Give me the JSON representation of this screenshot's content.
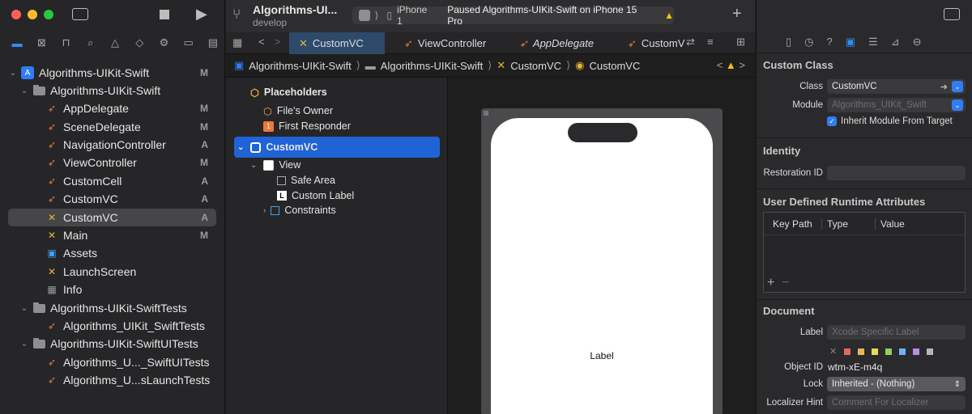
{
  "sidebar": {
    "window_controls": {
      "close": "#fe5f57",
      "minimize": "#febc2e",
      "zoom": "#28c840"
    },
    "nav_icons": [
      "folder-icon",
      "source-control-icon",
      "bookmark-icon",
      "find-icon",
      "issue-icon",
      "test-icon",
      "debug-icon",
      "breakpoint-icon",
      "report-icon"
    ],
    "items": [
      {
        "label": "Algorithms-UIKit-Swift",
        "badge": "M"
      },
      {
        "label": "Algorithms-UIKit-Swift",
        "badge": ""
      },
      {
        "label": "AppDelegate",
        "badge": "M"
      },
      {
        "label": "SceneDelegate",
        "badge": "M"
      },
      {
        "label": "NavigationController",
        "badge": "A"
      },
      {
        "label": "ViewController",
        "badge": "M"
      },
      {
        "label": "CustomCell",
        "badge": "A"
      },
      {
        "label": "CustomVC",
        "badge": "A"
      },
      {
        "label": "CustomVC",
        "badge": "A"
      },
      {
        "label": "Main",
        "badge": "M"
      },
      {
        "label": "Assets",
        "badge": ""
      },
      {
        "label": "LaunchScreen",
        "badge": ""
      },
      {
        "label": "Info",
        "badge": ""
      },
      {
        "label": "Algorithms-UIKit-SwiftTests",
        "badge": ""
      },
      {
        "label": "Algorithms_UIKit_SwiftTests",
        "badge": ""
      },
      {
        "label": "Algorithms-UIKit-SwiftUITests",
        "badge": ""
      },
      {
        "label": "Algorithms_U..._SwiftUITests",
        "badge": ""
      },
      {
        "label": "Algorithms_U...sLaunchTests",
        "badge": ""
      }
    ]
  },
  "header": {
    "project": "Algorithms-UI...",
    "branch": "develop",
    "device": "iPhone 1",
    "status": "Paused Algorithms-UIKit-Swift on iPhone 15 Pro"
  },
  "tabs": [
    "CustomVC",
    "ViewController",
    "AppDelegate",
    "CustomV"
  ],
  "jumpbar": [
    "Algorithms-UIKit-Swift",
    "Algorithms-UIKit-Swift",
    "CustomVC",
    "CustomVC"
  ],
  "outline": {
    "placeholders": "Placeholders",
    "files_owner": "File's Owner",
    "first_responder": "First Responder",
    "first_responder_badge": "1",
    "custom_vc": "CustomVC",
    "view": "View",
    "safe_area": "Safe Area",
    "custom_label": "Custom Label",
    "custom_label_icon": "L",
    "constraints": "Constraints"
  },
  "canvas": {
    "label_text": "Label"
  },
  "inspector": {
    "custom_class": {
      "title": "Custom Class",
      "class_label": "Class",
      "class_value": "CustomVC",
      "module_label": "Module",
      "module_value": "Algorithms_UIKit_Swift",
      "inherit_label": "Inherit Module From Target"
    },
    "identity": {
      "title": "Identity",
      "restoration_label": "Restoration ID",
      "restoration_value": ""
    },
    "runtime": {
      "title": "User Defined Runtime Attributes",
      "col_key": "Key Path",
      "col_type": "Type",
      "col_value": "Value",
      "add": "+",
      "remove": "−"
    },
    "document": {
      "title": "Document",
      "label_label": "Label",
      "label_placeholder": "Xcode Specific Label",
      "swatches": [
        "#e06b60",
        "#eab45a",
        "#e8d95a",
        "#8fcf67",
        "#6fb4f0",
        "#b48ee8",
        "#b7b7bb"
      ],
      "object_id_label": "Object ID",
      "object_id_value": "wtm-xE-m4q",
      "lock_label": "Lock",
      "lock_value": "Inherited - (Nothing)",
      "localizer_label": "Localizer Hint",
      "localizer_placeholder": "Comment For Localizer"
    }
  }
}
